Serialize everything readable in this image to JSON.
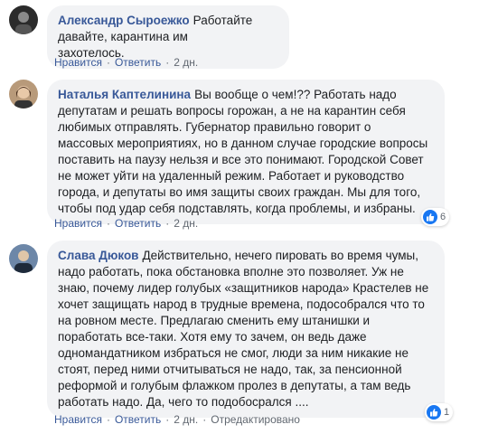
{
  "comments": [
    {
      "author": "Александр Сыроежко",
      "text": "Работайте давайте, карантина им\nзахотелось.",
      "like_label": "Нравится",
      "reply_label": "Ответить",
      "time": "2 дн."
    },
    {
      "author": "Наталья Каптелинина",
      "text": "Вы вообще о чем!?? Работать надо\nдепутатам и решать вопросы горожан, а не на карантин себя\nлюбимых отправлять. Губернатор правильно говорит о\nмассовых мероприятиях, но в данном случае городские вопросы\nпоставить на паузу нельзя и все это понимают. Городской Совет\nне может уйти на удаленный режим. Работает и руководство\nгорода, и депутаты во имя защиты своих граждан. Мы для того,\nчтобы под удар себя подставлять, когда проблемы, и избраны.",
      "like_label": "Нравится",
      "reply_label": "Ответить",
      "time": "2 дн.",
      "reaction_count": "6"
    },
    {
      "author": "Слава Дюков",
      "text": "Действительно, нечего пировать во время чумы,\nнадо работать, пока обстановка вполне это позволяет. Уж не\nзнаю, почему лидер голубых «защитников народа» Крастелев не\nхочет защищать народ в трудные времена, подособрался что то\nна ровном месте. Предлагаю сменить ему штанишки и\nпоработать все-таки. Хотя ему то зачем, он ведь даже\nодномандатником избраться не смог, люди за ним никакие не\nстоят, перед ними отчитываться не надо, так, за пенсионной\nреформой и голубым флажком пролез в депутаты, а там ведь\nработать надо. Да, чего то подобосрался ....",
      "like_label": "Нравится",
      "reply_label": "Ответить",
      "time": "2 дн.",
      "edited_label": "Отредактировано",
      "reaction_count": "1"
    }
  ],
  "colors": {
    "name": "#385898",
    "bubble": "#f2f3f5",
    "like": "#1877f2"
  }
}
